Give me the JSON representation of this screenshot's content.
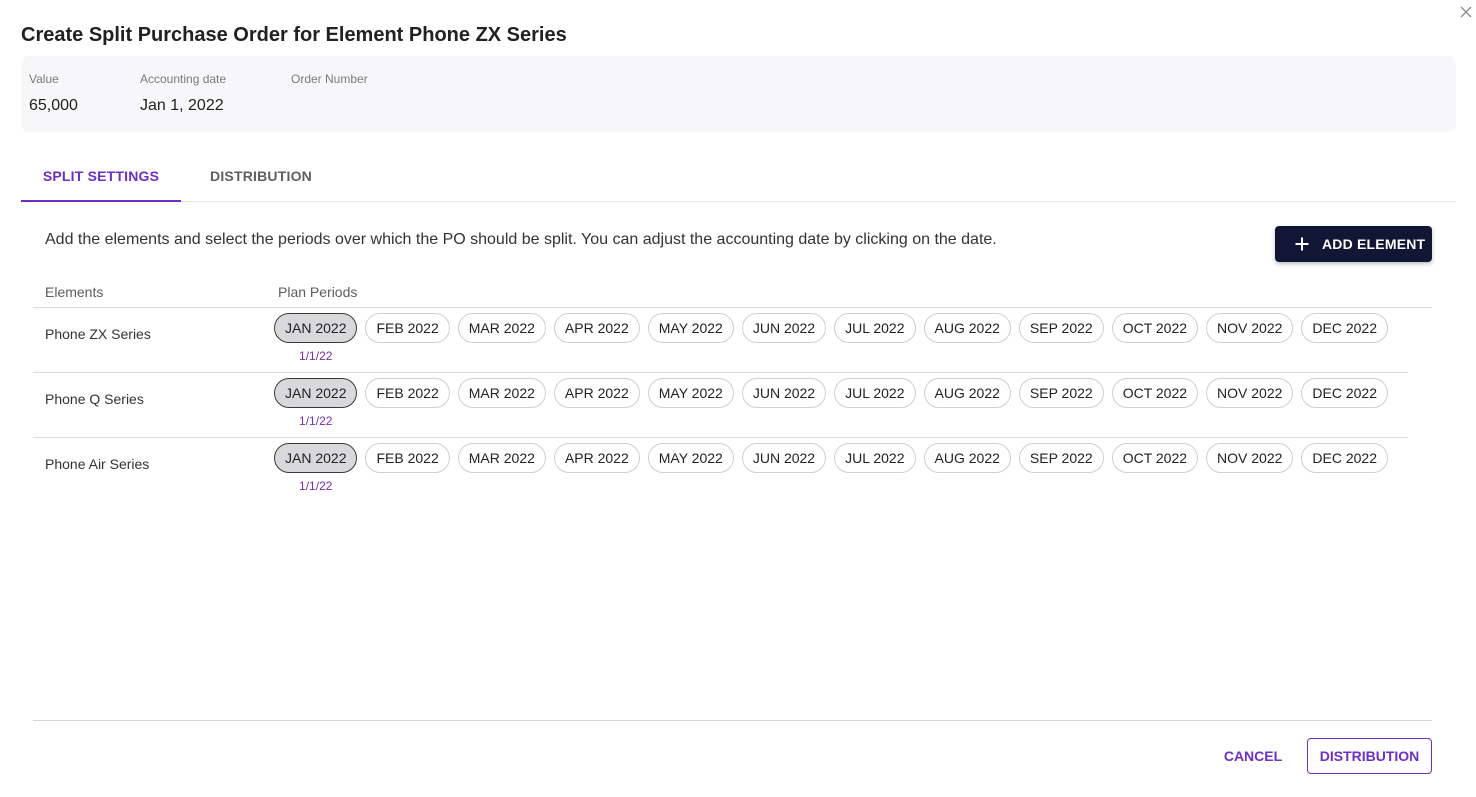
{
  "dialog": {
    "title": "Create Split Purchase Order for Element Phone ZX Series"
  },
  "summary": {
    "value_label": "Value",
    "value": "65,000",
    "accounting_date_label": "Accounting date",
    "accounting_date": "Jan 1, 2022",
    "order_number_label": "Order Number",
    "order_number": ""
  },
  "tabs": [
    {
      "label": "SPLIT SETTINGS",
      "active": true
    },
    {
      "label": "DISTRIBUTION",
      "active": false
    }
  ],
  "instructions": "Add the elements and select the periods over which the PO should be split. You can adjust the accounting date by clicking on the date.",
  "add_element_label": "ADD ELEMENT",
  "columns": {
    "elements": "Elements",
    "plan_periods": "Plan Periods"
  },
  "periods": [
    "JAN 2022",
    "FEB 2022",
    "MAR 2022",
    "APR 2022",
    "MAY 2022",
    "JUN 2022",
    "JUL 2022",
    "AUG 2022",
    "SEP 2022",
    "OCT 2022",
    "NOV 2022",
    "DEC 2022"
  ],
  "elements": [
    {
      "name": "Phone ZX Series",
      "selected_period": "JAN 2022",
      "date": "1/1/22"
    },
    {
      "name": "Phone Q Series",
      "selected_period": "JAN 2022",
      "date": "1/1/22"
    },
    {
      "name": "Phone Air Series",
      "selected_period": "JAN 2022",
      "date": "1/1/22"
    }
  ],
  "footer": {
    "cancel_label": "CANCEL",
    "distribution_label": "DISTRIBUTION"
  },
  "colors": {
    "accent": "#6e2fc4",
    "primary_button": "#111634",
    "selected_chip": "#d9d9dc",
    "date_text": "#7a2fa8"
  },
  "icons": {
    "close": "close-icon",
    "add": "plus-icon"
  }
}
